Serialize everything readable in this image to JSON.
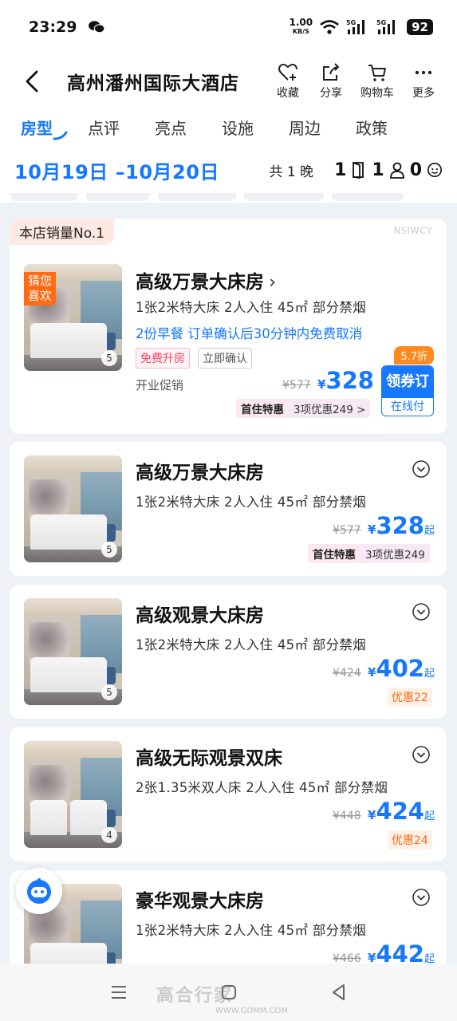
{
  "status_bar": {
    "time": "23:29",
    "net_speed": "1.00",
    "net_unit": "KB/S",
    "signal1": "5G",
    "signal2": "5G",
    "battery": "92"
  },
  "header": {
    "title": "高州潘州国际大酒店",
    "actions": [
      {
        "label": "收藏",
        "icon": "heart-plus-icon"
      },
      {
        "label": "分享",
        "icon": "share-icon"
      },
      {
        "label": "购物车",
        "icon": "cart-icon"
      },
      {
        "label": "更多",
        "icon": "more-icon"
      }
    ]
  },
  "tabs": [
    "房型",
    "点评",
    "亮点",
    "设施",
    "周边",
    "政策"
  ],
  "date_bar": {
    "dates": "10月19日 –10月20日",
    "nights": "共 1 晚",
    "rooms": "1",
    "adults": "1",
    "children": "0"
  },
  "featured": {
    "sales_badge": "本店销量No.1",
    "code": "NSIWCY",
    "guess_badge": "猜您喜欢",
    "photo_count": "5",
    "name": "高级万景大床房",
    "spec": "1张2米特大床  2人入住  45㎡  部分禁烟",
    "breakfast": "2份早餐   订单确认后30分钟内免费取消",
    "tag_upgrade": "免费升房",
    "tag_confirm": "立即确认",
    "opening": "开业促销",
    "old_price": "¥577",
    "yen": "¥",
    "price": "328",
    "discount": "5.7折",
    "book_top": "领券订",
    "book_bottom": "在线付",
    "first_promo_a": "首住特惠",
    "first_promo_b": "3项优惠249 >"
  },
  "rooms": [
    {
      "name": "高级万景大床房",
      "spec": "1张2米特大床  2人入住  45㎡  部分禁烟",
      "photo_count": "5",
      "old_price": "¥577",
      "yen": "¥",
      "price": "328",
      "qi": "起",
      "first_promo_a": "首住特惠",
      "first_promo_b": "3项优惠249"
    },
    {
      "name": "高级观景大床房",
      "spec": "1张2米特大床  2人入住  45㎡  部分禁烟",
      "photo_count": "5",
      "old_price": "¥424",
      "yen": "¥",
      "price": "402",
      "qi": "起",
      "promo": "优惠22"
    },
    {
      "name": "高级无际观景双床",
      "spec": "2张1.35米双人床  2人入住  45㎡  部分禁烟",
      "photo_count": "4",
      "old_price": "¥448",
      "yen": "¥",
      "price": "424",
      "qi": "起",
      "promo": "优惠24"
    },
    {
      "name": "豪华观景大床房",
      "spec": "1张2米特大床  2人入住  45㎡  部分禁烟",
      "old_price": "¥466",
      "yen": "¥",
      "price": "442",
      "qi": "起"
    }
  ],
  "watermark": {
    "mark": "高合行家",
    "url": "WWW.GDMM.COM"
  },
  "colors": {
    "accent": "#1677ff",
    "orange": "#ff6a13",
    "background": "#eef2f6"
  }
}
